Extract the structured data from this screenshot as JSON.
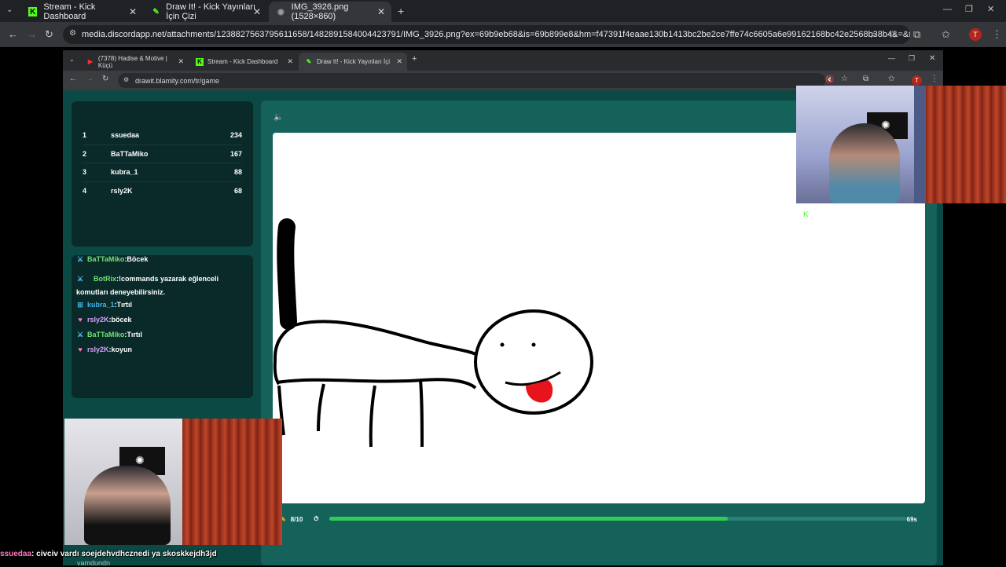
{
  "outer_browser": {
    "tabs": [
      {
        "label": "Stream - Kick Dashboard",
        "icon": "kick-logo-icon"
      },
      {
        "label": "Draw It! - Kick Yayınları İçin Çizi",
        "icon": "drawit-icon"
      },
      {
        "label": "IMG_3926.png (1528×860)",
        "icon": "discord-icon"
      }
    ],
    "new_tab": "+",
    "url": "media.discordapp.net/attachments/1238827563795611658/1482891584004423791/IMG_3926.png?ex=69b9eb68&is=69b899e8&hm=f47391f4eaae130b1413bc2be2ce7ffe74c6605a6e99162168bc42e2568b38b4&=&format=webp&quality=l...",
    "profile_initial": "T"
  },
  "inner_browser": {
    "tabs": [
      {
        "label": "(7378) Hadise & Motive | Küçü",
        "icon": "youtube-icon"
      },
      {
        "label": "Stream - Kick Dashboard",
        "icon": "kick-logo-icon"
      },
      {
        "label": "Draw It! - Kick Yayınları İçi",
        "icon": "drawit-icon"
      }
    ],
    "new_tab": "+",
    "url": "drawit.blamity.com/tr/game",
    "profile_initial": "T"
  },
  "scoreboard": [
    {
      "rank": "1",
      "name": "ssuedaa",
      "score": "234"
    },
    {
      "rank": "2",
      "name": "BaTTaMiko",
      "score": "167"
    },
    {
      "rank": "3",
      "name": "kubra_1",
      "score": "88"
    },
    {
      "rank": "4",
      "name": "rsly2K",
      "score": "68"
    }
  ],
  "chat": [
    {
      "user": "BaTTaMiko",
      "text": "Böcek",
      "user_color": "#6fe36f",
      "badge": "sword-icon"
    },
    {
      "user": "BotRix",
      "text": "!commands yazarak eğlenceli",
      "user_color": "#6fe36f",
      "badge": "sword-icon"
    },
    {
      "user": "",
      "text": "komutları deneyebilirsiniz.",
      "user_color": "#fff",
      "badge": ""
    },
    {
      "user": "kubra_1",
      "text": "Tırtıl",
      "user_color": "#3fb6e8",
      "badge": "gift-icon"
    },
    {
      "user": "rsly2K",
      "text": "böcek",
      "user_color": "#d7a0ff",
      "badge": "heart-icon"
    },
    {
      "user": "BaTTaMiko",
      "text": "Tırtıl",
      "user_color": "#6fe36f",
      "badge": "sword-icon"
    },
    {
      "user": "rsly2K",
      "text": "koyun",
      "user_color": "#d7a0ff",
      "badge": "heart-icon"
    }
  ],
  "game": {
    "round": "8/10",
    "time_left": "69s",
    "progress_fraction": 0.69
  },
  "overlay_chat": {
    "user": "ssuedaa",
    "message": ": civciv vardı soejdehvdhcznedi ya skoskkejdh3jd",
    "partial_below": "vamdundn"
  },
  "colors": {
    "kick_green": "#53fc18",
    "progress_green": "#2ecc55",
    "page_teal": "#0b4a44"
  }
}
